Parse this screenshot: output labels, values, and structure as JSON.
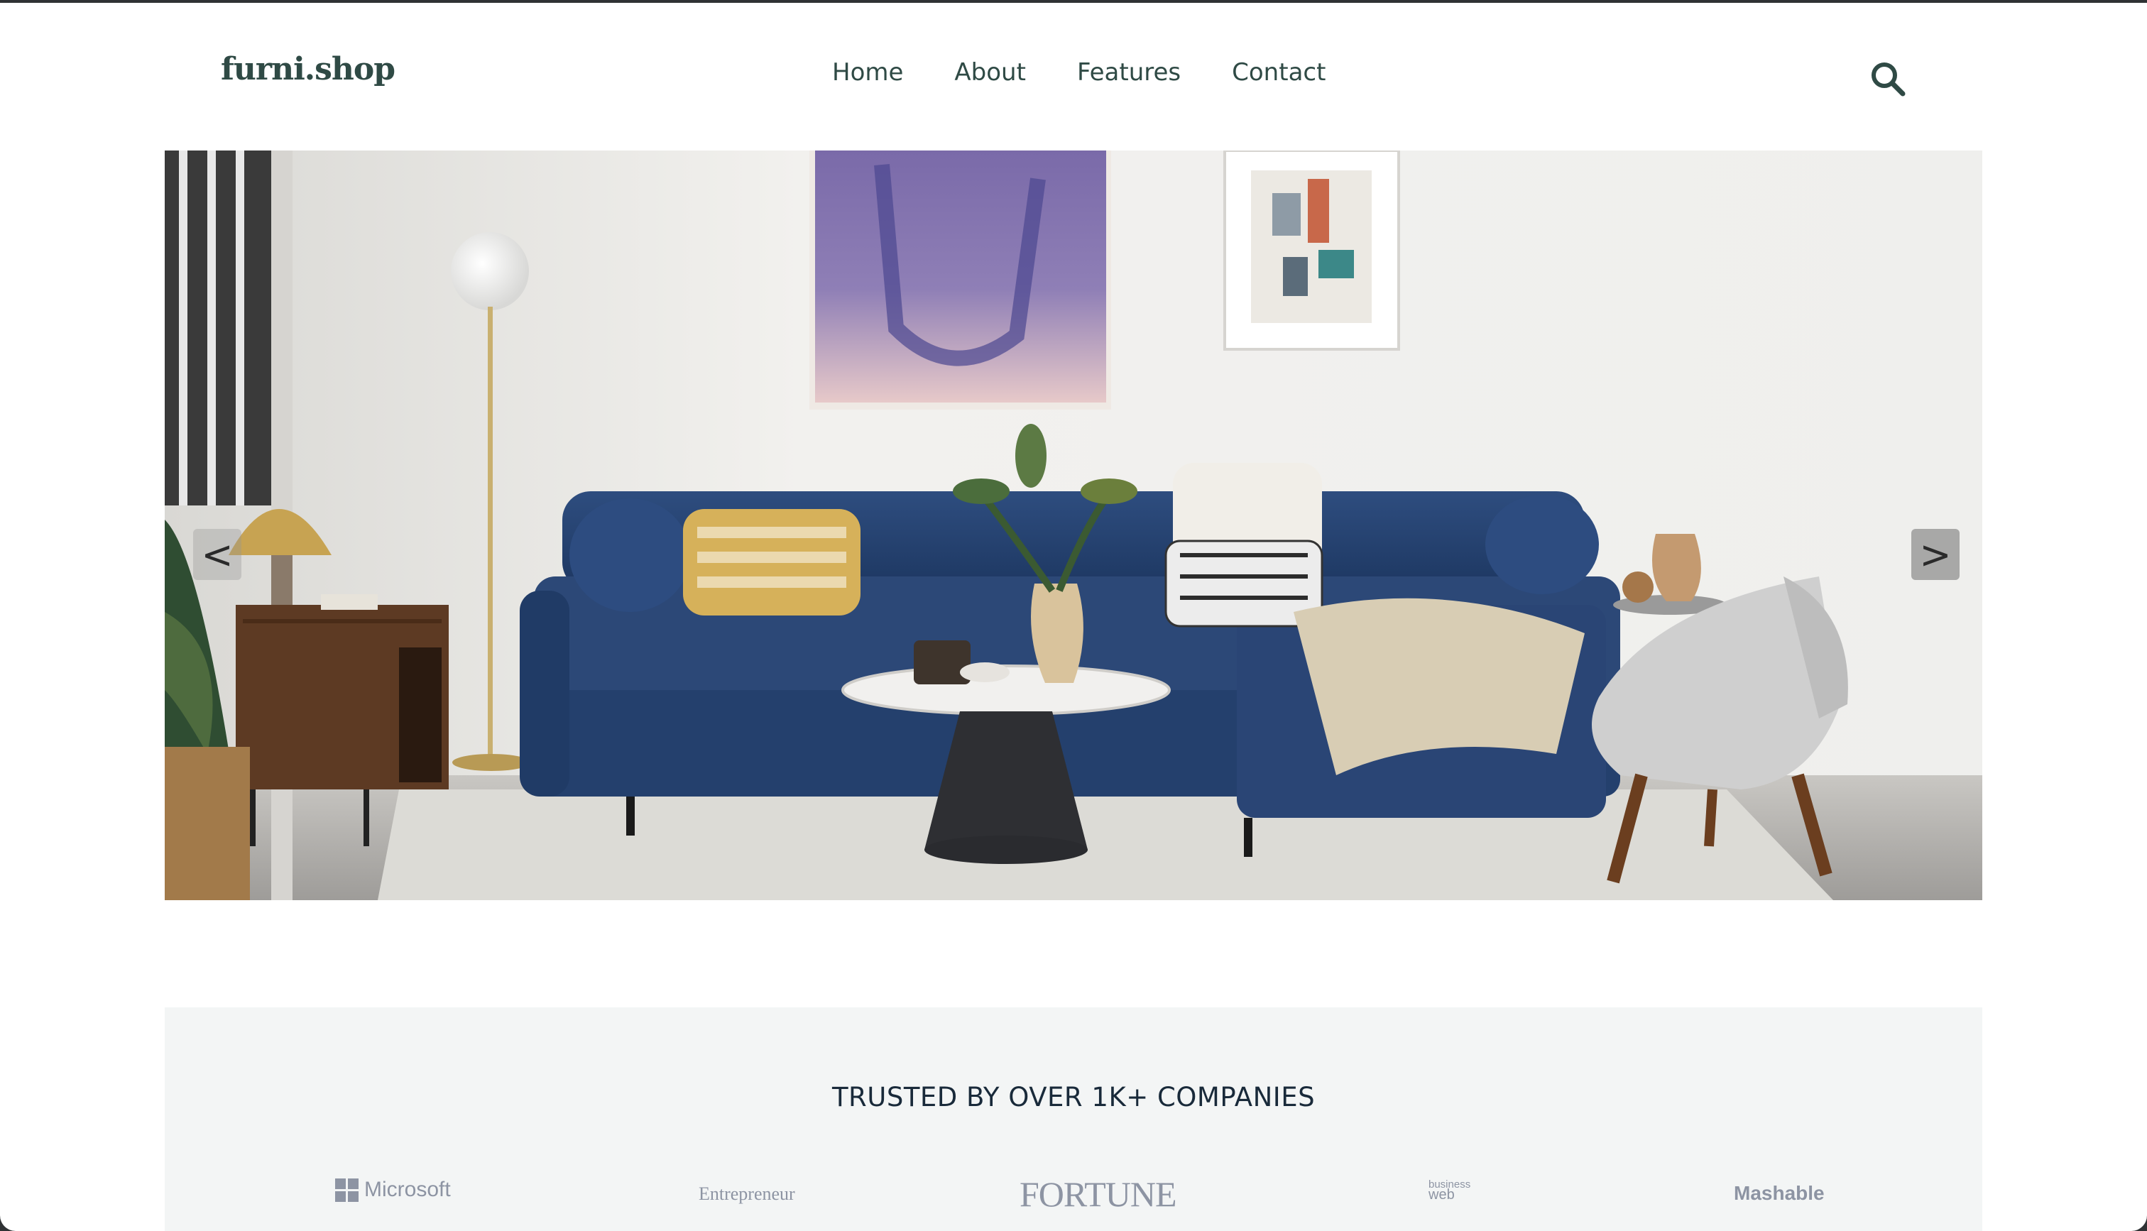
{
  "header": {
    "logo": "furni.shop",
    "nav": [
      "Home",
      "About",
      "Features",
      "Contact"
    ],
    "search_icon": "search-icon"
  },
  "hero": {
    "prev_label": "<",
    "next_label": ">"
  },
  "trusted": {
    "title": "TRUSTED BY OVER 1K+ COMPANIES",
    "brands": {
      "microsoft": "Microsoft",
      "entrepreneur": "Entrepreneur",
      "fortune": "FORTUNE",
      "business_web_line1": "business",
      "business_web_line2": "web",
      "mashable": "Mashable"
    }
  },
  "colors": {
    "brand_dark": "#2f4a45",
    "heading": "#192a3a",
    "section_bg": "#f3f5f5"
  }
}
